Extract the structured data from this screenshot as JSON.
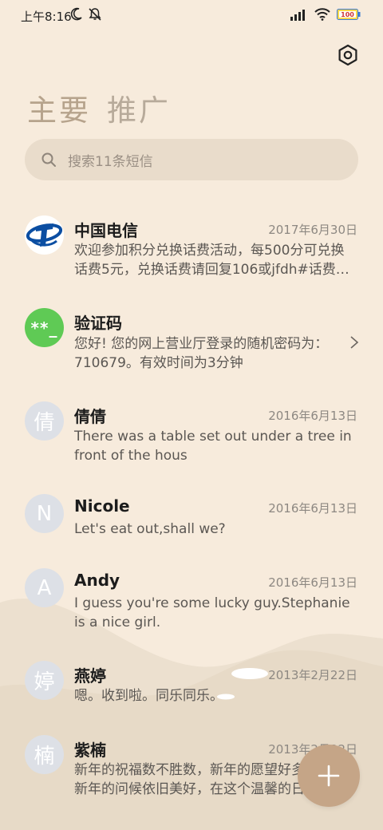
{
  "status": {
    "time": "上午8:16",
    "battery": "100"
  },
  "tabs": [
    {
      "label": "主要"
    },
    {
      "label": "推广"
    }
  ],
  "search": {
    "placeholder": "搜索11条短信"
  },
  "messages": [
    {
      "sender": "中国电信",
      "date": "2017年6月30日",
      "preview": "欢迎参加积分兑换话费活动，每500分可兑换话费5元，兑换话费请回复106或jfdh#话费…",
      "avatar": "telecom-logo"
    },
    {
      "sender": "验证码",
      "date": "",
      "preview": "您好! 您的网上营业厅登录的随机密码为：710679。有效时间为3分钟",
      "avatar_text": "**_"
    },
    {
      "sender": "倩倩",
      "date": "2016年6月13日",
      "preview": "There was a table set out under a tree in front of the hous",
      "avatar_text": "倩"
    },
    {
      "sender": "Nicole",
      "date": "2016年6月13日",
      "preview": "Let's eat out,shall we?",
      "avatar_text": "N"
    },
    {
      "sender": "Andy",
      "date": "2016年6月13日",
      "preview": "I guess you're some lucky guy.Stephanie is a nice girl.",
      "avatar_text": "A"
    },
    {
      "sender": "燕婷",
      "date": "2013年2月22日",
      "preview": "嗯。收到啦。同乐同乐。",
      "avatar_text": "婷"
    },
    {
      "sender": "紫楠",
      "date": "2013年2月22日",
      "preview": "新年的祝福数不胜数，新年的愿望好多好多，新年的问候依旧美好，在这个温馨的日子里",
      "avatar_text": "楠"
    }
  ],
  "colors": {
    "background": "#f7ebdc",
    "accent": "#c5a587",
    "tab_text": "#b6a38c",
    "hill_light": "#ede1d0",
    "hill_dark": "#e2d3bf"
  }
}
